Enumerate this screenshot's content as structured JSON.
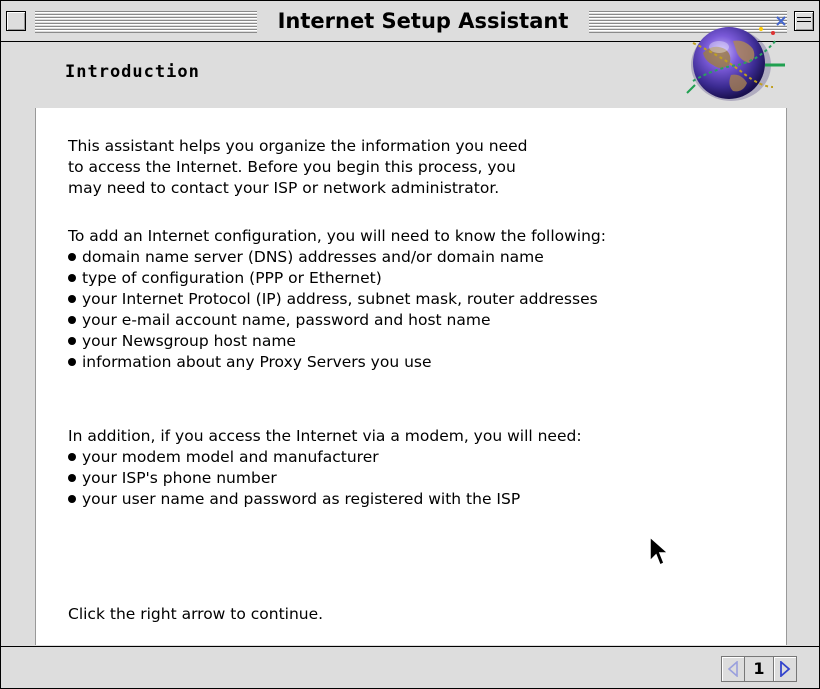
{
  "window": {
    "title": "Internet Setup Assistant"
  },
  "header": {
    "page_title": "Introduction",
    "illustration_icon": "globe-icon"
  },
  "content": {
    "intro_lines": [
      "This assistant helps you organize the information you need",
      "to access the Internet.  Before you begin this process, you",
      "may need to contact your ISP or network administrator."
    ],
    "config_heading": "To add an Internet configuration, you will need to know the following:",
    "config_items": [
      "domain name server (DNS) addresses and/or domain name",
      "type of configuration (PPP or Ethernet)",
      "your Internet Protocol (IP) address, subnet mask, router addresses",
      "your e-mail account name, password and host name",
      "your Newsgroup host name",
      "information about any Proxy Servers you use"
    ],
    "modem_heading": "In addition, if you access the Internet via a modem, you will need:",
    "modem_items": [
      "your modem model and manufacturer",
      "your ISP's phone number",
      "your user name and password as registered with the ISP"
    ],
    "continue_text": "Click the right arrow to continue."
  },
  "footer": {
    "page_number": "1",
    "back_icon": "left-arrow-icon",
    "next_icon": "right-arrow-icon"
  },
  "colors": {
    "chrome": "#dddddd",
    "content_bg": "#ffffff",
    "arrow_accent": "#3344cc",
    "arrow_disabled": "#9aa0dd"
  }
}
